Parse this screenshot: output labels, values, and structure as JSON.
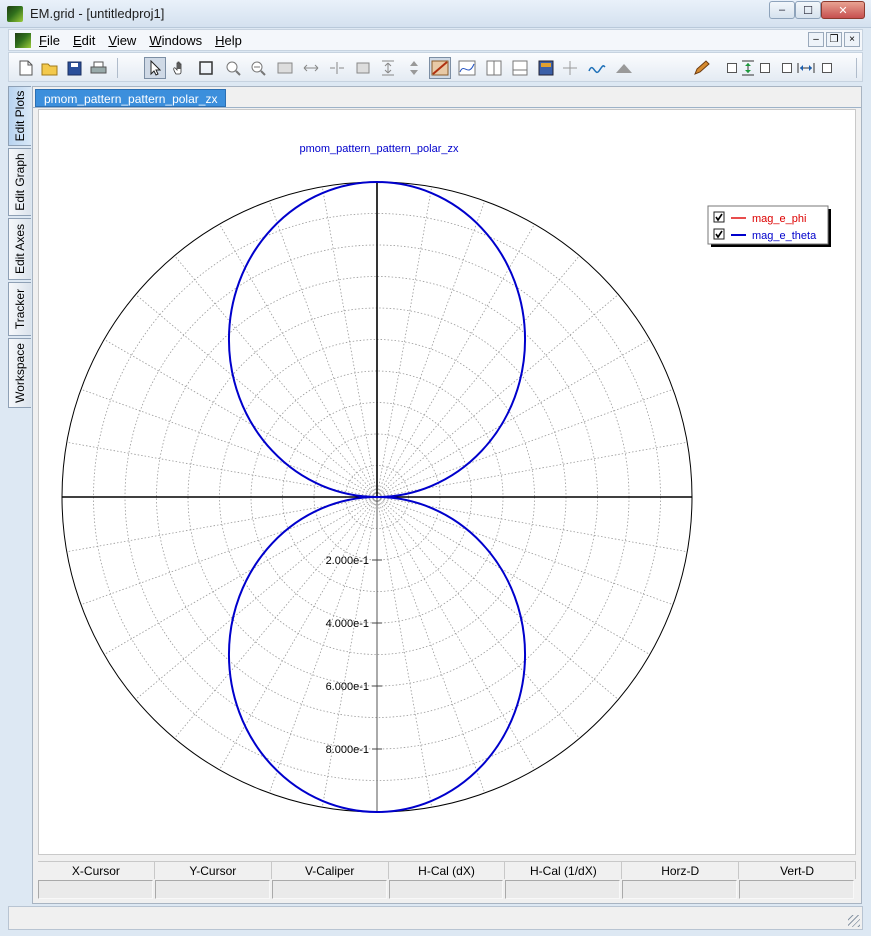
{
  "window": {
    "title": "EM.grid - [untitledproj1]",
    "minimize": "–",
    "maximize": "☐",
    "close": "✕"
  },
  "menu": {
    "items": [
      {
        "u": "F",
        "rest": "ile"
      },
      {
        "u": "E",
        "rest": "dit"
      },
      {
        "u": "V",
        "rest": "iew"
      },
      {
        "u": "W",
        "rest": "indows"
      },
      {
        "u": "H",
        "rest": "elp"
      }
    ],
    "mdi": {
      "minimize": "–",
      "restore": "❐",
      "close": "×"
    }
  },
  "toolbar": {
    "icons": [
      "new-file-icon",
      "open-folder-icon",
      "save-icon",
      "print-icon",
      "pointer-icon",
      "pan-hand-icon",
      "zoom-fit-icon",
      "zoom-in-icon",
      "zoom-out-icon",
      "fit-page-icon",
      "fit-width-icon",
      "fit-h-icon",
      "fit-v-icon",
      "fit-height-icon",
      "stretch-v-icon",
      "auto-scale-icon",
      "graph-options-icon",
      "v-split-icon",
      "h-split-icon",
      "color-map-icon",
      "crosshair-icon",
      "curve-icon",
      "peak-icon",
      "pencil-icon"
    ]
  },
  "side_tabs": [
    "Edit Plots",
    "Edit Graph",
    "Edit Axes",
    "Tracker",
    "Workspace"
  ],
  "document": {
    "tab_label": "pmom_pattern_pattern_polar_zx"
  },
  "cursor_table": {
    "headers": [
      "X-Cursor",
      "Y-Cursor",
      "V-Caliper",
      "H-Cal (dX)",
      "H-Cal (1/dX)",
      "Horz-D",
      "Vert-D"
    ]
  },
  "colors": {
    "theta": "#0000cc",
    "phi": "#dd0000",
    "tab_active": "#3c8fdc",
    "title_text": "#0000cc"
  },
  "chart_data": {
    "type": "polar",
    "title": "pmom_pattern_pattern_polar_zx",
    "rlim": [
      0,
      1.0
    ],
    "radial_tick_labels": [
      "2.000e-1",
      "4.000e-1",
      "6.000e-1",
      "8.000e-1"
    ],
    "radial_ticks": [
      0.2,
      0.4,
      0.6,
      0.8
    ],
    "grid": true,
    "legend": {
      "placement": "top-right"
    },
    "series": [
      {
        "name": "mag_e_phi",
        "color": "#dd0000",
        "checked": true,
        "theta_deg": [],
        "r": []
      },
      {
        "name": "mag_e_theta",
        "color": "#0000cc",
        "checked": true,
        "theta_deg": [
          0,
          15,
          30,
          45,
          60,
          75,
          90,
          105,
          120,
          135,
          150,
          165,
          180,
          195,
          210,
          225,
          240,
          255,
          270,
          285,
          300,
          315,
          330,
          345,
          360
        ],
        "r": [
          0,
          0.259,
          0.5,
          0.707,
          0.866,
          0.966,
          1.0,
          0.966,
          0.866,
          0.707,
          0.5,
          0.259,
          0,
          0.259,
          0.5,
          0.707,
          0.866,
          0.966,
          1.0,
          0.966,
          0.866,
          0.707,
          0.5,
          0.259,
          0
        ]
      }
    ]
  }
}
